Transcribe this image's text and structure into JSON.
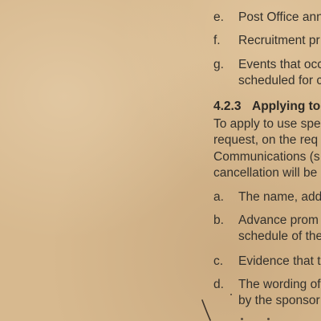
{
  "list_top": [
    {
      "letter": "e.",
      "lines": [
        "Post Office ann"
      ]
    },
    {
      "letter": "f.",
      "lines": [
        "Recruitment pr"
      ]
    },
    {
      "letter": "g.",
      "lines": [
        "Events that occ",
        "scheduled for c"
      ]
    }
  ],
  "section": {
    "number": "4.2.3",
    "title": "Applying to"
  },
  "paragraph": [
    "To apply to use spe",
    "request, on the req",
    "Communications (s",
    "cancellation will be"
  ],
  "list_bottom": [
    {
      "letter": "a.",
      "lines": [
        "The name, add"
      ]
    },
    {
      "letter": "b.",
      "lines": [
        "Advance prom",
        "schedule of the"
      ]
    },
    {
      "letter": "c.",
      "lines": [
        "Evidence that t"
      ]
    },
    {
      "letter": "d.",
      "lines": [
        "The wording of",
        "by the sponsor"
      ]
    }
  ]
}
